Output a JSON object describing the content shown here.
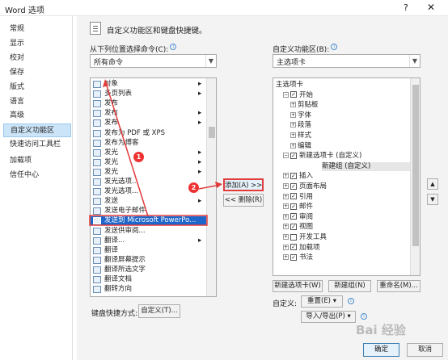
{
  "window": {
    "title": "Word 选项",
    "help": "?",
    "close": "✕"
  },
  "nav": [
    {
      "label": "常规"
    },
    {
      "label": "显示"
    },
    {
      "label": "校对"
    },
    {
      "label": "保存"
    },
    {
      "label": "版式"
    },
    {
      "label": "语言"
    },
    {
      "label": "高级"
    },
    {
      "label": "自定义功能区",
      "selected": true
    },
    {
      "label": "快速访问工具栏"
    },
    {
      "label": "加载项"
    },
    {
      "label": "信任中心"
    }
  ],
  "header": {
    "text": "自定义功能区和键盘快捷键。"
  },
  "left": {
    "choose_label": "从下列位置选择命令(C):",
    "choose_value": "所有命令",
    "items": [
      {
        "label": "对象",
        "arrow": true
      },
      {
        "label": "多页列表",
        "arrow": true
      },
      {
        "label": "发布"
      },
      {
        "label": "发布",
        "arrow": true
      },
      {
        "label": "发布",
        "arrow": true
      },
      {
        "label": "发布为 PDF 或 XPS"
      },
      {
        "label": "发布为博客"
      },
      {
        "label": "发光",
        "arrow": true
      },
      {
        "label": "发光",
        "arrow": true
      },
      {
        "label": "发光",
        "arrow": true
      },
      {
        "label": "发光选项..."
      },
      {
        "label": "发光选项..."
      },
      {
        "label": "发送",
        "arrow": true
      },
      {
        "label": "发送电子邮件"
      },
      {
        "label": "发送到 Microsoft PowerPo...",
        "highlighted": true
      },
      {
        "label": "发送供审阅..."
      },
      {
        "label": "翻译...",
        "arrow": true
      },
      {
        "label": "翻译"
      },
      {
        "label": "翻译屏幕提示"
      },
      {
        "label": "翻译所选文字"
      },
      {
        "label": "翻译文档"
      },
      {
        "label": "翻转方向"
      }
    ],
    "shortcut_label": "键盘快捷方式:",
    "shortcut_button": "自定义(T)..."
  },
  "middle": {
    "add_button": "添加(A) >>",
    "remove_button": "<< 删除(R)"
  },
  "right": {
    "customize_label": "自定义功能区(B):",
    "customize_value": "主选项卡",
    "tree": [
      {
        "label": "主选项卡",
        "indent": 0
      },
      {
        "label": "开始",
        "indent": 1,
        "exp": "⊟",
        "checked": true
      },
      {
        "label": "剪贴板",
        "indent": 2,
        "exp": "⊞"
      },
      {
        "label": "字体",
        "indent": 2,
        "exp": "⊞"
      },
      {
        "label": "段落",
        "indent": 2,
        "exp": "⊞"
      },
      {
        "label": "样式",
        "indent": 2,
        "exp": "⊞"
      },
      {
        "label": "编辑",
        "indent": 2,
        "exp": "⊞"
      },
      {
        "label": "新建选项卡 (自定义)",
        "indent": 1,
        "exp": "⊟",
        "checked": true
      },
      {
        "label": "新建组 (自定义)",
        "indent": 3
      },
      {
        "label": "插入",
        "indent": 1,
        "exp": "⊞",
        "checked": true
      },
      {
        "label": "页面布局",
        "indent": 1,
        "exp": "⊞",
        "checked": true
      },
      {
        "label": "引用",
        "indent": 1,
        "exp": "⊞",
        "checked": true
      },
      {
        "label": "邮件",
        "indent": 1,
        "exp": "⊞",
        "checked": true
      },
      {
        "label": "审阅",
        "indent": 1,
        "exp": "⊞",
        "checked": true
      },
      {
        "label": "视图",
        "indent": 1,
        "exp": "⊞",
        "checked": true
      },
      {
        "label": "开发工具",
        "indent": 1,
        "exp": "⊞",
        "checked": false
      },
      {
        "label": "加载项",
        "indent": 1,
        "exp": "⊞",
        "checked": true
      },
      {
        "label": "书法",
        "indent": 1,
        "exp": "⊞",
        "checked": true
      }
    ],
    "new_tab_button": "新建选项卡(W)",
    "new_group_button": "新建组(N)",
    "rename_button": "重命名(M)...",
    "customize_label2": "自定义:",
    "reset_button": "重置(E) ▾",
    "import_export_button": "导入/导出(P) ▾"
  },
  "footer": {
    "ok_button": "确定",
    "cancel_button": "取消"
  },
  "annotations": {
    "badge1": "1",
    "badge2": "2"
  },
  "watermark": "Bai 经验"
}
